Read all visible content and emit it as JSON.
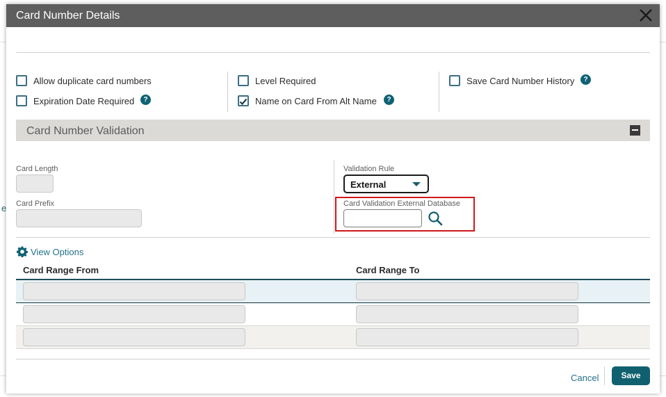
{
  "dialog": {
    "title": "Card Number Details"
  },
  "options": {
    "allow_duplicate": {
      "label": "Allow duplicate card numbers",
      "checked": false
    },
    "expiration_required": {
      "label": "Expiration Date Required",
      "checked": false
    },
    "level_required": {
      "label": "Level Required",
      "checked": false
    },
    "name_from_alt": {
      "label": "Name on Card From Alt Name",
      "checked": true
    },
    "save_history": {
      "label": "Save Card Number History",
      "checked": false
    },
    "help_glyph": "?"
  },
  "validation": {
    "section_title": "Card Number Validation",
    "card_length_label": "Card Length",
    "card_prefix_label": "Card Prefix",
    "rule_label": "Validation Rule",
    "rule_value": "External",
    "external_db_label": "Card Validation External Database",
    "external_db_value": ""
  },
  "table": {
    "view_options_label": "View Options",
    "col_from": "Card Range From",
    "col_to": "Card Range To",
    "rows": [
      {
        "from": "",
        "to": ""
      },
      {
        "from": "",
        "to": ""
      },
      {
        "from": "",
        "to": ""
      }
    ]
  },
  "footer": {
    "cancel_label": "Cancel",
    "save_label": "Save"
  },
  "colors": {
    "accent": "#10606f",
    "titlebar": "#5e5e5e",
    "highlight_border": "#d0171b"
  }
}
